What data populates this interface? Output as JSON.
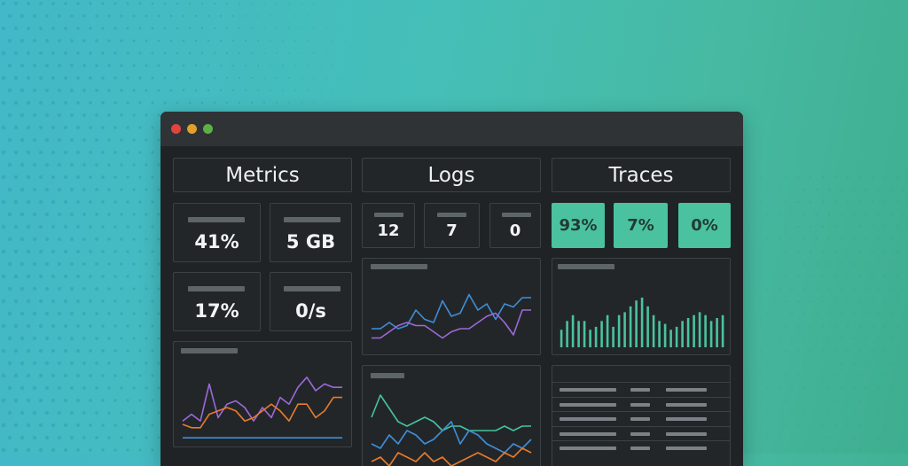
{
  "window": {
    "traffic_lights": {
      "close": "#e0443e",
      "minimize": "#e0a02a",
      "maximize": "#5cb046"
    }
  },
  "colors": {
    "accent_green": "#4ac2a0",
    "line_blue": "#3f8fd8",
    "line_purple": "#9b6ad8",
    "line_orange": "#e87b2c",
    "line_green": "#44c49c"
  },
  "metrics": {
    "title": "Metrics",
    "stats": [
      {
        "value": "41%"
      },
      {
        "value": "5 GB"
      },
      {
        "value": "17%"
      },
      {
        "value": "0/s"
      }
    ],
    "chart_data": {
      "type": "line",
      "x": [
        0,
        1,
        2,
        3,
        4,
        5,
        6,
        7,
        8,
        9,
        10,
        11,
        12,
        13,
        14,
        15,
        16,
        17,
        18
      ],
      "series": [
        {
          "color": "#9b6ad8",
          "values": [
            0.3,
            0.4,
            0.3,
            0.85,
            0.35,
            0.55,
            0.6,
            0.5,
            0.3,
            0.5,
            0.35,
            0.65,
            0.55,
            0.8,
            0.95,
            0.75,
            0.85,
            0.8,
            0.8
          ]
        },
        {
          "color": "#e87b2c",
          "values": [
            0.25,
            0.2,
            0.2,
            0.4,
            0.45,
            0.5,
            0.45,
            0.3,
            0.35,
            0.45,
            0.55,
            0.45,
            0.3,
            0.55,
            0.55,
            0.35,
            0.45,
            0.65,
            0.65
          ]
        },
        {
          "color": "#3f8fd8",
          "values": [
            0.05,
            0.05,
            0.05,
            0.05,
            0.05,
            0.05,
            0.05,
            0.05,
            0.05,
            0.05,
            0.05,
            0.05,
            0.05,
            0.05,
            0.05,
            0.05,
            0.05,
            0.05,
            0.05
          ]
        }
      ]
    }
  },
  "logs": {
    "title": "Logs",
    "stats": [
      {
        "value": "12"
      },
      {
        "value": "7"
      },
      {
        "value": "0"
      }
    ],
    "chart_top": {
      "type": "line",
      "x": [
        0,
        1,
        2,
        3,
        4,
        5,
        6,
        7,
        8,
        9,
        10,
        11,
        12,
        13,
        14,
        15,
        16,
        17,
        18
      ],
      "series": [
        {
          "color": "#3f8fd8",
          "values": [
            0.3,
            0.3,
            0.4,
            0.3,
            0.35,
            0.6,
            0.45,
            0.4,
            0.75,
            0.5,
            0.55,
            0.85,
            0.6,
            0.7,
            0.45,
            0.7,
            0.65,
            0.8,
            0.8
          ]
        },
        {
          "color": "#9b6ad8",
          "values": [
            0.15,
            0.15,
            0.25,
            0.35,
            0.4,
            0.35,
            0.35,
            0.25,
            0.15,
            0.25,
            0.3,
            0.3,
            0.4,
            0.5,
            0.55,
            0.4,
            0.2,
            0.6,
            0.6
          ]
        }
      ]
    },
    "chart_bottom": {
      "type": "line",
      "x": [
        0,
        1,
        2,
        3,
        4,
        5,
        6,
        7,
        8,
        9,
        10,
        11,
        12,
        13,
        14,
        15,
        16,
        17,
        18
      ],
      "series": [
        {
          "color": "#44c49c",
          "values": [
            0.6,
            0.85,
            0.7,
            0.55,
            0.5,
            0.55,
            0.6,
            0.55,
            0.45,
            0.5,
            0.5,
            0.45,
            0.45,
            0.45,
            0.45,
            0.5,
            0.45,
            0.5,
            0.5
          ]
        },
        {
          "color": "#3f8fd8",
          "values": [
            0.3,
            0.25,
            0.4,
            0.3,
            0.45,
            0.4,
            0.3,
            0.35,
            0.45,
            0.55,
            0.3,
            0.45,
            0.4,
            0.3,
            0.25,
            0.2,
            0.3,
            0.25,
            0.35
          ]
        },
        {
          "color": "#e87b2c",
          "values": [
            0.1,
            0.15,
            0.05,
            0.2,
            0.15,
            0.1,
            0.2,
            0.1,
            0.15,
            0.05,
            0.1,
            0.15,
            0.2,
            0.15,
            0.1,
            0.2,
            0.15,
            0.25,
            0.2
          ]
        }
      ]
    }
  },
  "traces": {
    "title": "Traces",
    "stats": [
      {
        "value": "93%"
      },
      {
        "value": "7%"
      },
      {
        "value": "0%"
      }
    ],
    "histogram": {
      "type": "bar",
      "values": [
        0.3,
        0.45,
        0.55,
        0.45,
        0.45,
        0.3,
        0.35,
        0.45,
        0.55,
        0.35,
        0.55,
        0.6,
        0.7,
        0.8,
        0.85,
        0.7,
        0.55,
        0.45,
        0.4,
        0.3,
        0.35,
        0.45,
        0.5,
        0.55,
        0.6,
        0.55,
        0.45,
        0.5,
        0.55
      ]
    },
    "table_rows": 5
  }
}
